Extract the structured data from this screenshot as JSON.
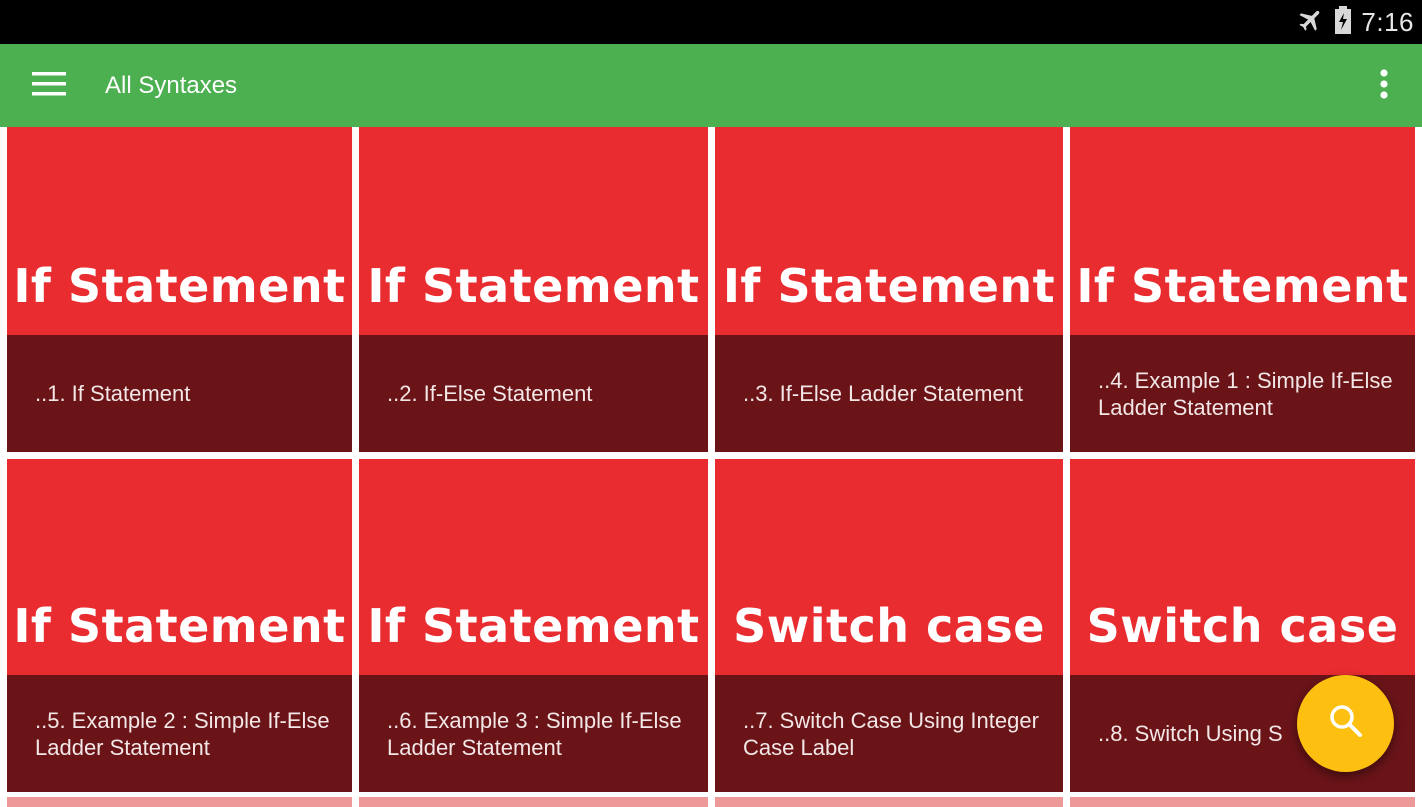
{
  "status_bar": {
    "time": "7:16",
    "icons": [
      "airplane-mode-icon",
      "battery-charging-icon"
    ]
  },
  "app_bar": {
    "title": "All Syntaxes",
    "nav_icon": "hamburger-menu-icon",
    "overflow_icon": "more-vert-icon"
  },
  "cards": [
    {
      "banner": "If Statement",
      "caption": "..1. If Statement"
    },
    {
      "banner": "If Statement",
      "caption": "..2. If-Else Statement"
    },
    {
      "banner": "If Statement",
      "caption": "..3. If-Else Ladder Statement"
    },
    {
      "banner": "If Statement",
      "caption": "..4. Example 1 : Simple If-Else Ladder Statement"
    },
    {
      "banner": "If Statement",
      "caption": "..5. Example 2 : Simple If-Else Ladder Statement"
    },
    {
      "banner": "If Statement",
      "caption": "..6. Example 3 : Simple If-Else Ladder Statement"
    },
    {
      "banner": "Switch case",
      "caption": "..7. Switch Case Using Integer Case Label"
    },
    {
      "banner": "Switch case",
      "caption": "..8. Switch Using S"
    }
  ],
  "fab": {
    "icon": "search-icon"
  },
  "colors": {
    "app_bar": "#4caf50",
    "banner": "#e92c30",
    "caption": "#6a1418",
    "fab": "#fdc010"
  }
}
